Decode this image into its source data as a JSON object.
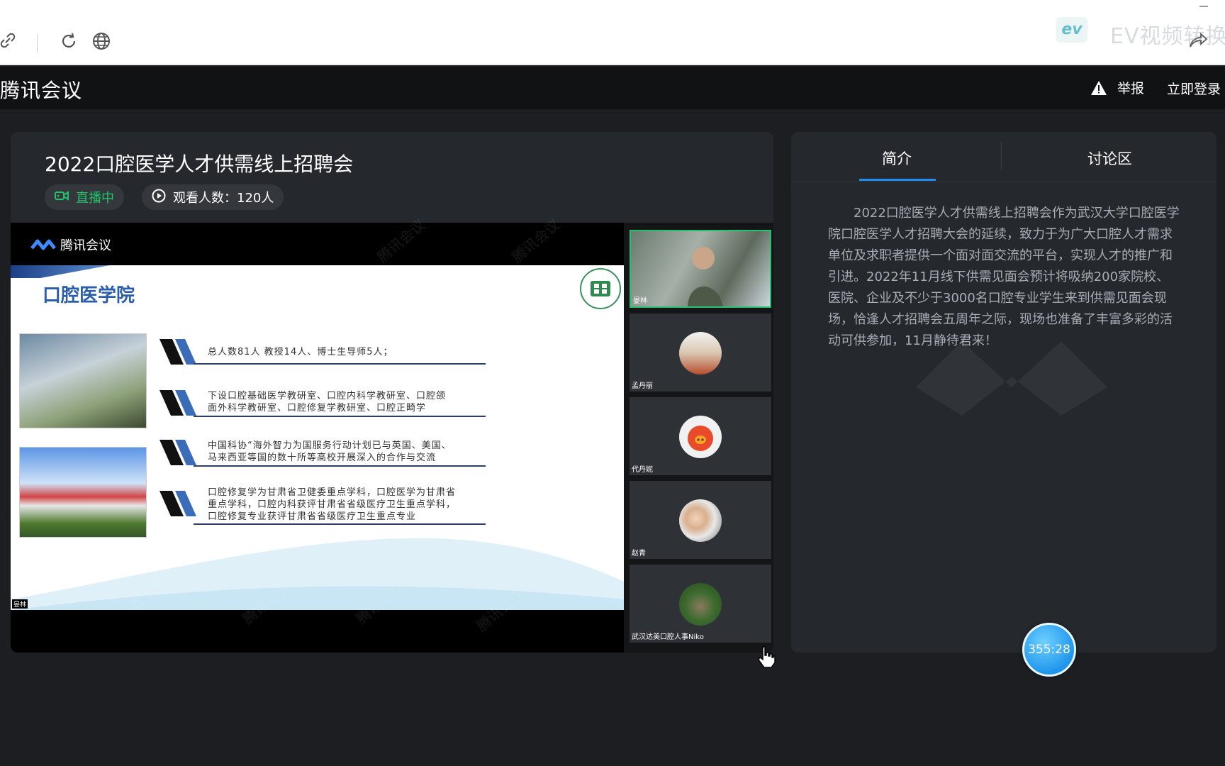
{
  "browser": {
    "ev_logo_text": "ev",
    "ev_watermark": "EV视频转换"
  },
  "header": {
    "app_title": "腾讯会议",
    "report_label": "举报",
    "login_label": "立即登录"
  },
  "meeting": {
    "title": "2022口腔医学人才供需线上招聘会",
    "live_label": "直播中",
    "viewers_label": "观看人数：120人"
  },
  "slide": {
    "brand": "腾讯会议",
    "title": "口腔医学院",
    "bullets": [
      "总人数81人   教授14人、博士生导师5人；",
      "下设口腔基础医学教研室、口腔内科学教研室、口腔颌\n面外科学教研室、口腔修复学教研室、口腔正畸学",
      "中国科协“海外智力为国服务行动计划已与英国、美国、\n马来西亚等国的数十所等高校开展深入的合作与交流",
      "口腔修复学为甘肃省卫健委重点学科，口腔医学为甘肃省\n重点学科，口腔内科获评甘肃省省级医疗卫生重点学科，\n口腔修复专业获评甘肃省省级医疗卫生重点专业"
    ],
    "caption": "晏林",
    "watermark": "腾讯会议"
  },
  "participants": [
    {
      "name": "晏林",
      "active": true
    },
    {
      "name": "孟丹丽",
      "active": false
    },
    {
      "name": "代丹妮",
      "active": false
    },
    {
      "name": "赵青",
      "active": false
    },
    {
      "name": "武汉达美口腔人事Niko",
      "active": false
    }
  ],
  "side": {
    "tab_intro": "简介",
    "tab_discuss": "讨论区",
    "intro_text": "2022口腔医学人才供需线上招聘会作为武汉大学口腔医学院口腔医学人才招聘大会的延续，致力于为广大口腔人才需求单位及求职者提供一个面对面交流的平台，实现人才的推广和引进。2022年11月线下供需见面会预计将吸纳200家院校、医院、企业及不少于3000名口腔专业学生来到供需见面会现场，恰逢人才招聘会五周年之际，现场也准备了丰富多彩的活动可供参加，11月静待君来！"
  },
  "timer": "355:28",
  "colors": {
    "live_green": "#24c26a",
    "tab_active": "#1e8cf0",
    "slide_title": "#2a5ea8"
  }
}
